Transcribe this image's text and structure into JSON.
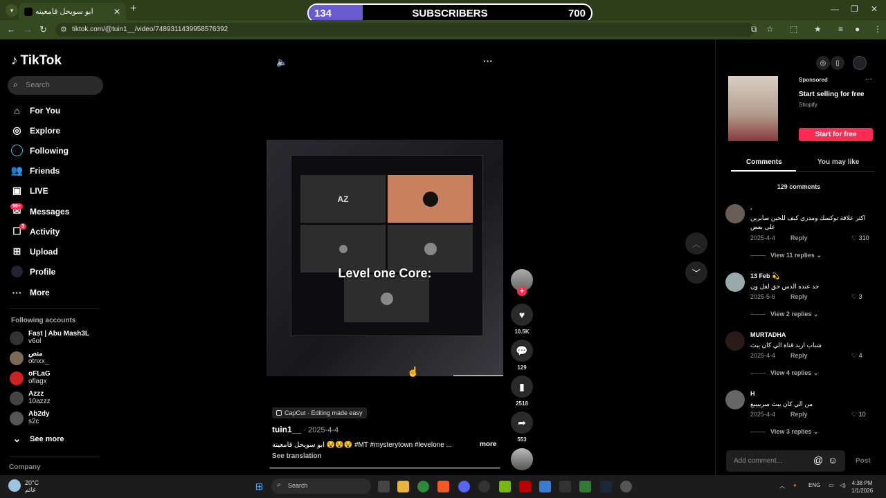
{
  "browser": {
    "tab_title": "ابو سويحل قامعينه",
    "url": "tiktok.com/@tuin1__/video/7489311439958576392"
  },
  "overlay": {
    "start": "134",
    "label": "SUBSCRIBERS",
    "goal": "700",
    "progress_fraction": 0.19
  },
  "sidebar": {
    "brand": "TikTok",
    "search_placeholder": "Search",
    "items": [
      {
        "label": "For You",
        "icon": "home-icon"
      },
      {
        "label": "Explore",
        "icon": "compass-icon"
      },
      {
        "label": "Following",
        "icon": "following-icon"
      },
      {
        "label": "Friends",
        "icon": "friends-icon"
      },
      {
        "label": "LIVE",
        "icon": "live-icon"
      },
      {
        "label": "Messages",
        "icon": "messages-icon",
        "badge": "99+"
      },
      {
        "label": "Activity",
        "icon": "activity-icon",
        "badge": "3"
      },
      {
        "label": "Upload",
        "icon": "upload-icon"
      },
      {
        "label": "Profile",
        "icon": "profile-icon"
      },
      {
        "label": "More",
        "icon": "more-icon"
      }
    ],
    "following_title": "Following accounts",
    "accounts": [
      {
        "name": "Fast | Abu Mash3L",
        "handle": "v6ol"
      },
      {
        "name": "منص",
        "handle": "otnxx_"
      },
      {
        "name": "oFLaG",
        "handle": "oflagx"
      },
      {
        "name": "Azzz",
        "handle": "10azzz"
      },
      {
        "name": "Ab2dy",
        "handle": "s2c"
      }
    ],
    "see_more": "See more",
    "company": "Company"
  },
  "video": {
    "caption_overlay": "Level one Core:",
    "capcut": "CapCut · Editing made easy",
    "author": "tuin1__",
    "date": "· 2025-4-4",
    "description": "ابو سويحل قامعينه 😵😵😵 #MT #mysterytown #levelone ...",
    "more": "more",
    "see_translation": "See translation"
  },
  "actions": {
    "likes": "10.5K",
    "comments": "129",
    "saves": "2518",
    "shares": "553"
  },
  "ad": {
    "sponsored": "Sponsored",
    "title": "Start selling for free",
    "brand": "Shopify",
    "cta": "Start for free"
  },
  "panel": {
    "tab_comments": "Comments",
    "tab_like": "You may like",
    "count": "129 comments",
    "add_placeholder": "Add comment...",
    "post": "Post",
    "reply_label": "Reply"
  },
  "comments": [
    {
      "name": ".",
      "text": "اكثر علاقة توكسك ومدري كيف للحين صابرين على بعض",
      "date": "2025-4-4",
      "likes": "310",
      "replies": "View 11 replies"
    },
    {
      "name": "13 Feb 💫",
      "text": "حد عنده الدس حق لفل ون",
      "date": "2025-5-6",
      "likes": "3",
      "replies": "View 2 replies"
    },
    {
      "name": "MURTADHA",
      "text": "شباب اريد قناة الي كان يبث",
      "date": "2025-4-4",
      "likes": "4",
      "replies": "View 4 replies"
    },
    {
      "name": "H",
      "text": "من الي كان يبث سرييييع",
      "date": "2025-4-4",
      "likes": "10",
      "replies": "View 3 replies"
    }
  ],
  "taskbar": {
    "temp": "20°C",
    "weather_text": "غائم",
    "search": "Search",
    "lang": "ENG",
    "time": "4:38 PM",
    "date": "1/1/2026"
  }
}
